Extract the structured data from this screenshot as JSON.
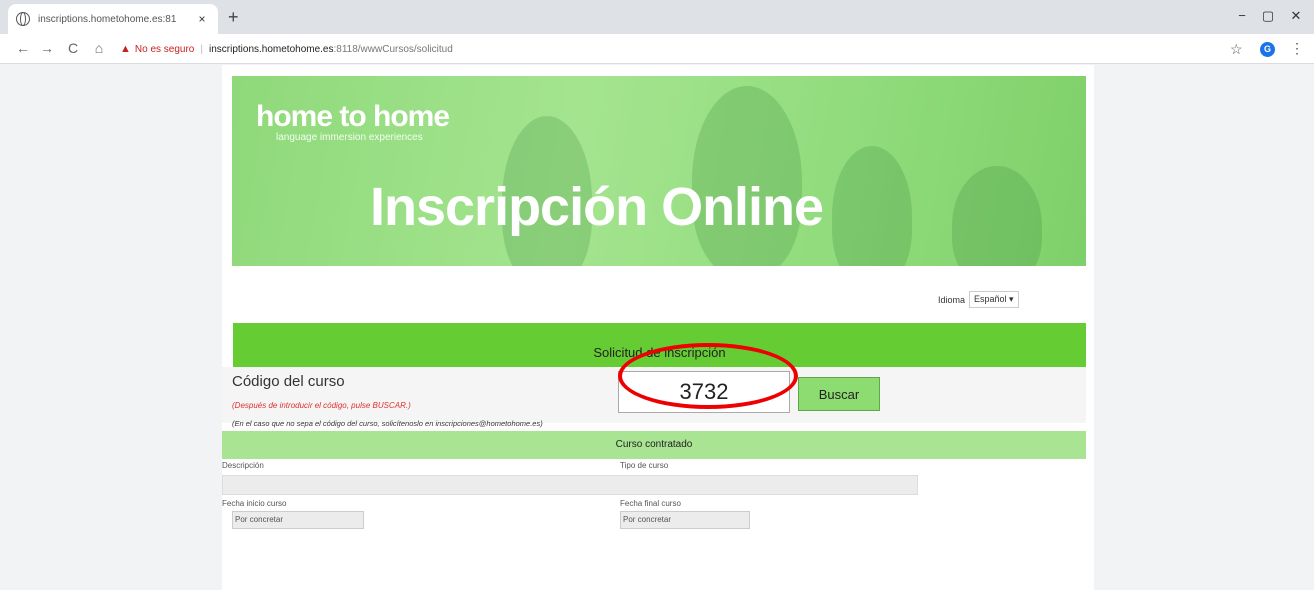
{
  "browser": {
    "tab_title": "inscriptions.hometohome.es:81",
    "tab_close": "×",
    "new_tab": "+",
    "window_controls": [
      "−",
      "▢",
      "✕"
    ],
    "nav": [
      "←",
      "→",
      "C",
      "⌂"
    ],
    "not_secure": "No es seguro",
    "url_host": "inscriptions.hometohome.es",
    "url_path": ":8118/wwwCursos/solicitud",
    "profile_initial": "G"
  },
  "banner": {
    "logo_main": "home to home",
    "logo_sub": "language immersion experiences",
    "title": "Inscripción Online"
  },
  "language": {
    "label": "Idioma",
    "selected": "Español ▾"
  },
  "form": {
    "section_title": "Solicitud de inscripción",
    "codigo_label": "Código del curso",
    "codigo_hint": "(Después de introducir el código, pulse BUSCAR.)",
    "codigo_value": "3732",
    "buscar_label": "Buscar",
    "note": "(En el caso que no sepa el código del curso, solicítenoslo en inscripciones@hometohome.es)",
    "curso_title": "Curso contratado",
    "descripcion_label": "Descripción",
    "tipo_label": "Tipo de curso",
    "fecha_inicio_label": "Fecha inicio curso",
    "fecha_final_label": "Fecha final curso",
    "fecha_inicio_value": "Por concretar",
    "fecha_final_value": "Por concretar"
  },
  "colors": {
    "section_green": "#66cc33",
    "light_green": "#a8e492",
    "annotation_red": "#e00000"
  }
}
